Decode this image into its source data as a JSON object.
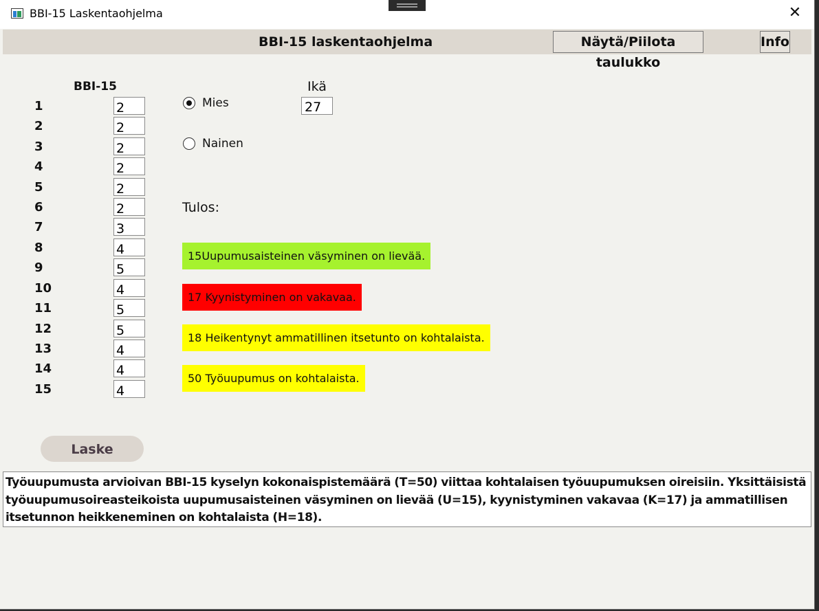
{
  "window": {
    "title": "BBI-15 Laskentaohjelma",
    "close_glyph": "✕"
  },
  "toolbar": {
    "heading": "BBI-15 laskentaohjelma",
    "toggle_table_label": "Näytä/Piilota taulukko",
    "info_label": "Info"
  },
  "questions": {
    "header": "BBI-15",
    "items": [
      {
        "number": "1",
        "value": "2"
      },
      {
        "number": "2",
        "value": "2"
      },
      {
        "number": "3",
        "value": "2"
      },
      {
        "number": "4",
        "value": "2"
      },
      {
        "number": "5",
        "value": "2"
      },
      {
        "number": "6",
        "value": "2"
      },
      {
        "number": "7",
        "value": "3"
      },
      {
        "number": "8",
        "value": "4"
      },
      {
        "number": "9",
        "value": "5"
      },
      {
        "number": "10",
        "value": "4"
      },
      {
        "number": "11",
        "value": "5"
      },
      {
        "number": "12",
        "value": "5"
      },
      {
        "number": "13",
        "value": "4"
      },
      {
        "number": "14",
        "value": "4"
      },
      {
        "number": "15",
        "value": "4"
      }
    ]
  },
  "gender": {
    "options": [
      {
        "label": "Mies",
        "checked": true
      },
      {
        "label": "Nainen",
        "checked": false
      }
    ]
  },
  "age": {
    "label": "Ikä",
    "value": "27"
  },
  "results": {
    "heading": "Tulos:",
    "items": [
      {
        "text": "15Uupumusaisteinen väsyminen on lievää.",
        "color": "#a6f22e"
      },
      {
        "text": "17 Kyynistyminen on vakavaa.",
        "color": "#ff0000"
      },
      {
        "text": "18 Heikentynyt ammatillinen itsetunto on kohtalaista.",
        "color": "#ffff00"
      },
      {
        "text": "50 Työuupumus on kohtalaista.",
        "color": "#ffff00"
      }
    ]
  },
  "calculate_label": "Laske",
  "summary": "Työuupumusta arvioivan BBI-15 kyselyn kokonaispistemäärä (T=50) viittaa kohtalaisen työuupumuksen oireisiin. Yksittäisistä työuupumusoireasteikoista uupumusaisteinen väsyminen on lievää (U=15), kyynistyminen vakavaa (K=17) ja ammatillisen itsetunnon heikkeneminen on kohtalaista (H=18)."
}
